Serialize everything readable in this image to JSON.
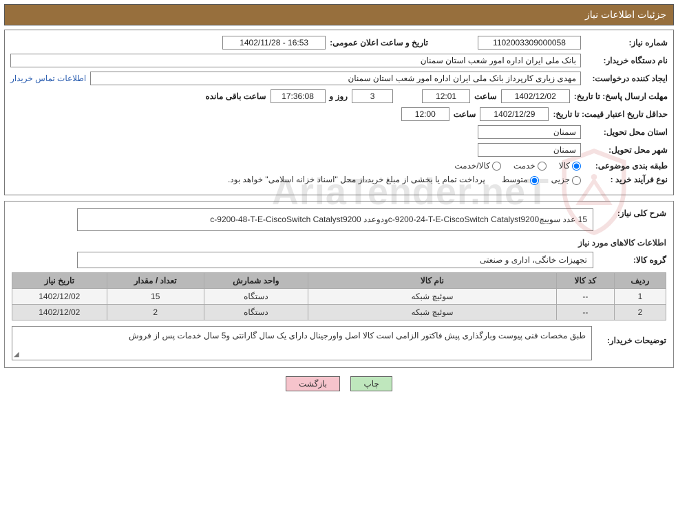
{
  "header": {
    "title": "جزئیات اطلاعات نیاز"
  },
  "meta": {
    "need_no_label": "شماره نیاز:",
    "need_no": "1102003309000058",
    "announce_label": "تاریخ و ساعت اعلان عمومی:",
    "announce_value": "16:53 - 1402/11/28",
    "org_label": "نام دستگاه خریدار:",
    "org_value": "بانک ملی ایران اداره امور شعب استان سمنان",
    "requester_label": "ایجاد کننده درخواست:",
    "requester_value": "مهدی زیاری کارپرداز بانک ملی ایران اداره امور شعب استان سمنان",
    "contact_link": "اطلاعات تماس خریدار",
    "deadline_label": "مهلت ارسال پاسخ:",
    "until_label": "تا تاریخ:",
    "deadline_date": "1402/12/02",
    "time_label": "ساعت",
    "deadline_time": "12:01",
    "days_label": "روز و",
    "days_left": "3",
    "countdown": "17:36:08",
    "remaining_label": "ساعت باقی مانده",
    "validity_label": "حداقل تاریخ اعتبار قیمت:",
    "validity_date": "1402/12/29",
    "validity_time": "12:00",
    "province_label": "استان محل تحویل:",
    "province_value": "سمنان",
    "city_label": "شهر محل تحویل:",
    "city_value": "سمنان",
    "category_label": "طبقه بندی موضوعی:",
    "cat_goods": "کالا",
    "cat_service": "خدمت",
    "cat_both": "کالا/خدمت",
    "purchase_type_label": "نوع فرآیند خرید :",
    "pt_minor": "جزیی",
    "pt_medium": "متوسط",
    "purchase_note": "پرداخت تمام یا بخشی از مبلغ خرید،از محل \"اسناد خزانه اسلامی\" خواهد بود."
  },
  "summary": {
    "label": "شرح کلی نیاز:",
    "text": "15 عدد سوییچc-9200-24-T-E-CiscoSwitch Catalyst9200ودوعدد c-9200-48-T-E-CiscoSwitch Catalyst9200"
  },
  "goods": {
    "heading": "اطلاعات کالاهای مورد نیاز",
    "group_label": "گروه کالا:",
    "group_value": "تجهیزات خانگی، اداری و صنعتی",
    "cols": {
      "row": "ردیف",
      "code": "کد کالا",
      "name": "نام کالا",
      "unit": "واحد شمارش",
      "qty": "تعداد / مقدار",
      "date": "تاریخ نیاز"
    },
    "rows": [
      {
        "row": "1",
        "code": "--",
        "name": "سوئیچ شبکه",
        "unit": "دستگاه",
        "qty": "15",
        "date": "1402/12/02"
      },
      {
        "row": "2",
        "code": "--",
        "name": "سوئیچ شبکه",
        "unit": "دستگاه",
        "qty": "2",
        "date": "1402/12/02"
      }
    ]
  },
  "buyer_notes": {
    "label": "توضیحات خریدار:",
    "text": "طبق مخصات فنی پیوست وبارگذاری پیش فاکتور الزامی است کالا اصل واورجینال دارای یک سال گارانتی و5 سال خدمات پس از فروش"
  },
  "buttons": {
    "print": "چاپ",
    "back": "بازگشت"
  },
  "watermark": {
    "text": "AriaTender.neT"
  }
}
